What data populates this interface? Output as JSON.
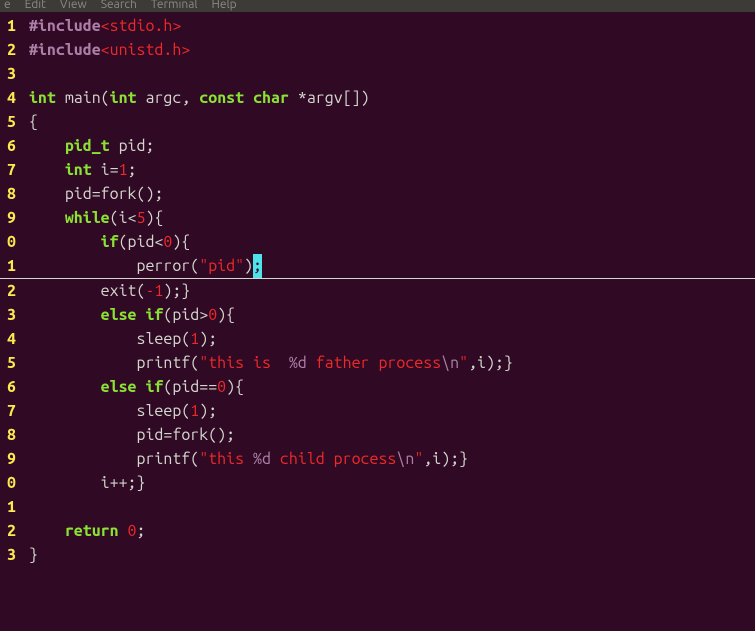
{
  "menubar": {
    "file": "e",
    "edit": "Edit",
    "view": "View",
    "search": "Search",
    "terminal": "Terminal",
    "help": "Help"
  },
  "gutter": {
    "l1": "1",
    "l2": "2",
    "l3": "3",
    "l4": "4",
    "l5": "5",
    "l6": "6",
    "l7": "7",
    "l8": "8",
    "l9": "9",
    "l10": "0",
    "l11": "1",
    "l12": "2",
    "l13": "3",
    "l14": "4",
    "l15": "5",
    "l16": "6",
    "l17": "7",
    "l18": "8",
    "l19": "9",
    "l20": "0",
    "l21": "1",
    "l22": "2",
    "l23": "3"
  },
  "t": {
    "sp1": " ",
    "include": "#include",
    "hdr_stdio": "<stdio.h>",
    "hdr_unistd": "<unistd.h>",
    "int": "int",
    "main": "main",
    "lparen": "(",
    "rparen": ")",
    "argc": "argc",
    "comma": ",",
    "const": "const",
    "char": "char",
    "star": "*",
    "argv": "argv",
    "lbrack": "[",
    "rbrack": "]",
    "lbrace": "{",
    "rbrace": "}",
    "ind1": "    ",
    "ind2": "        ",
    "ind3": "            ",
    "pid_t": "pid_t",
    "pid": "pid",
    "semi": ";",
    "i": "i",
    "eq": "=",
    "one": "1",
    "fork": "fork",
    "while": "while",
    "lt": "<",
    "five": "5",
    "if": "if",
    "zero": "0",
    "perror": "perror",
    "q_pid": "\"pid\"",
    "cursor_ch": ";",
    "exit": "exit",
    "neg1": "-1",
    "else": "else",
    "gt": ">",
    "sleep": "sleep",
    "printf": "printf",
    "q": "\"",
    "str_this_is": "this is  ",
    "fmt_d": "%d",
    "str_father": " father process",
    "esc_n": "\\n",
    "eqeq": "==",
    "str_this": "this ",
    "str_child": " child process",
    "plusplus": "++",
    "return": "return",
    "rbrace_end": "}"
  }
}
